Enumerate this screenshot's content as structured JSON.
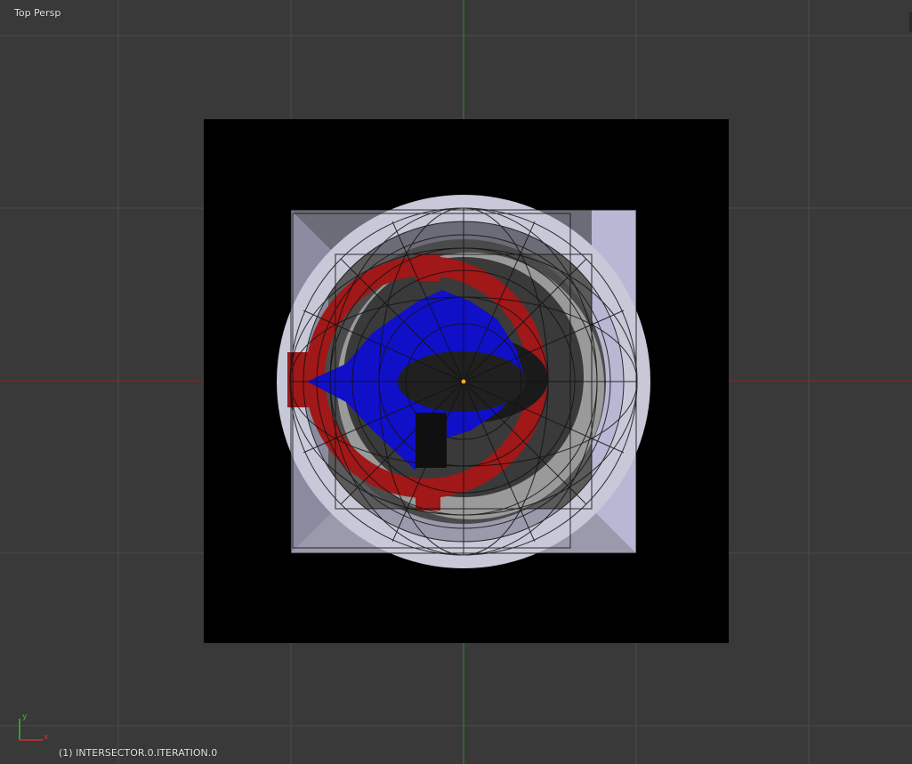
{
  "viewport": {
    "view_name": "Top Persp",
    "object_info": "(1) INTERSECTOR.0.ITERATION.0",
    "axis": {
      "x_label": "x",
      "y_label": "y"
    }
  },
  "colors": {
    "background": "#393939",
    "grid": "#4a4a4a",
    "x_axis": "#8b2323",
    "y_axis": "#2d8b2d",
    "scene_background": "#000000",
    "red_mesh": "#a01818",
    "blue_mesh": "#1010c8",
    "light_surface": "#b8b8d4",
    "origin_dot": "#ffa030"
  }
}
